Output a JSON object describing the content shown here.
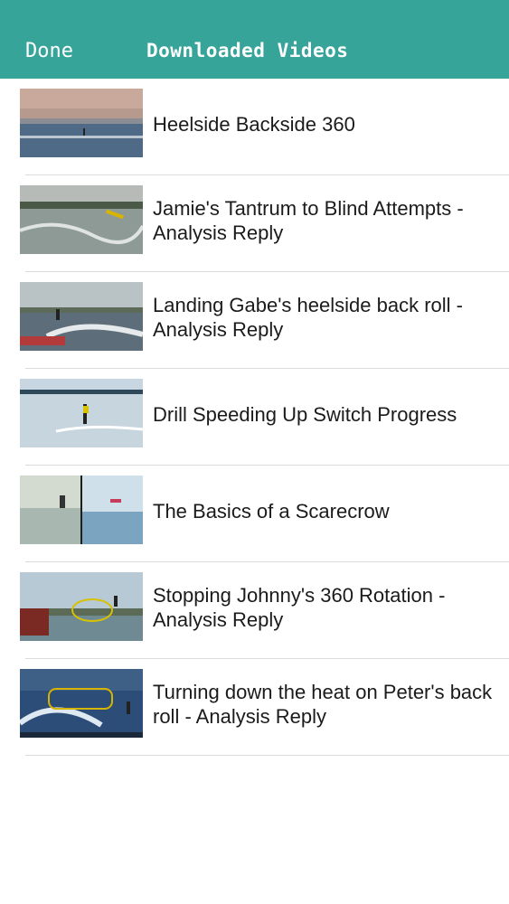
{
  "nav": {
    "done_label": "Done",
    "title": "Downloaded Videos",
    "background_color": "#37a49a"
  },
  "videos": [
    {
      "title": "Heelside Backside 360"
    },
    {
      "title": "Jamie's Tantrum to Blind Attempts - Analysis Reply"
    },
    {
      "title": "Landing Gabe's heelside back roll - Analysis Reply"
    },
    {
      "title": "Drill Speeding Up Switch Progress"
    },
    {
      "title": "The Basics of a Scarecrow"
    },
    {
      "title": "Stopping Johnny's 360 Rotation - Analysis Reply"
    },
    {
      "title": "Turning down the heat on Peter's back roll - Analysis Reply"
    }
  ]
}
